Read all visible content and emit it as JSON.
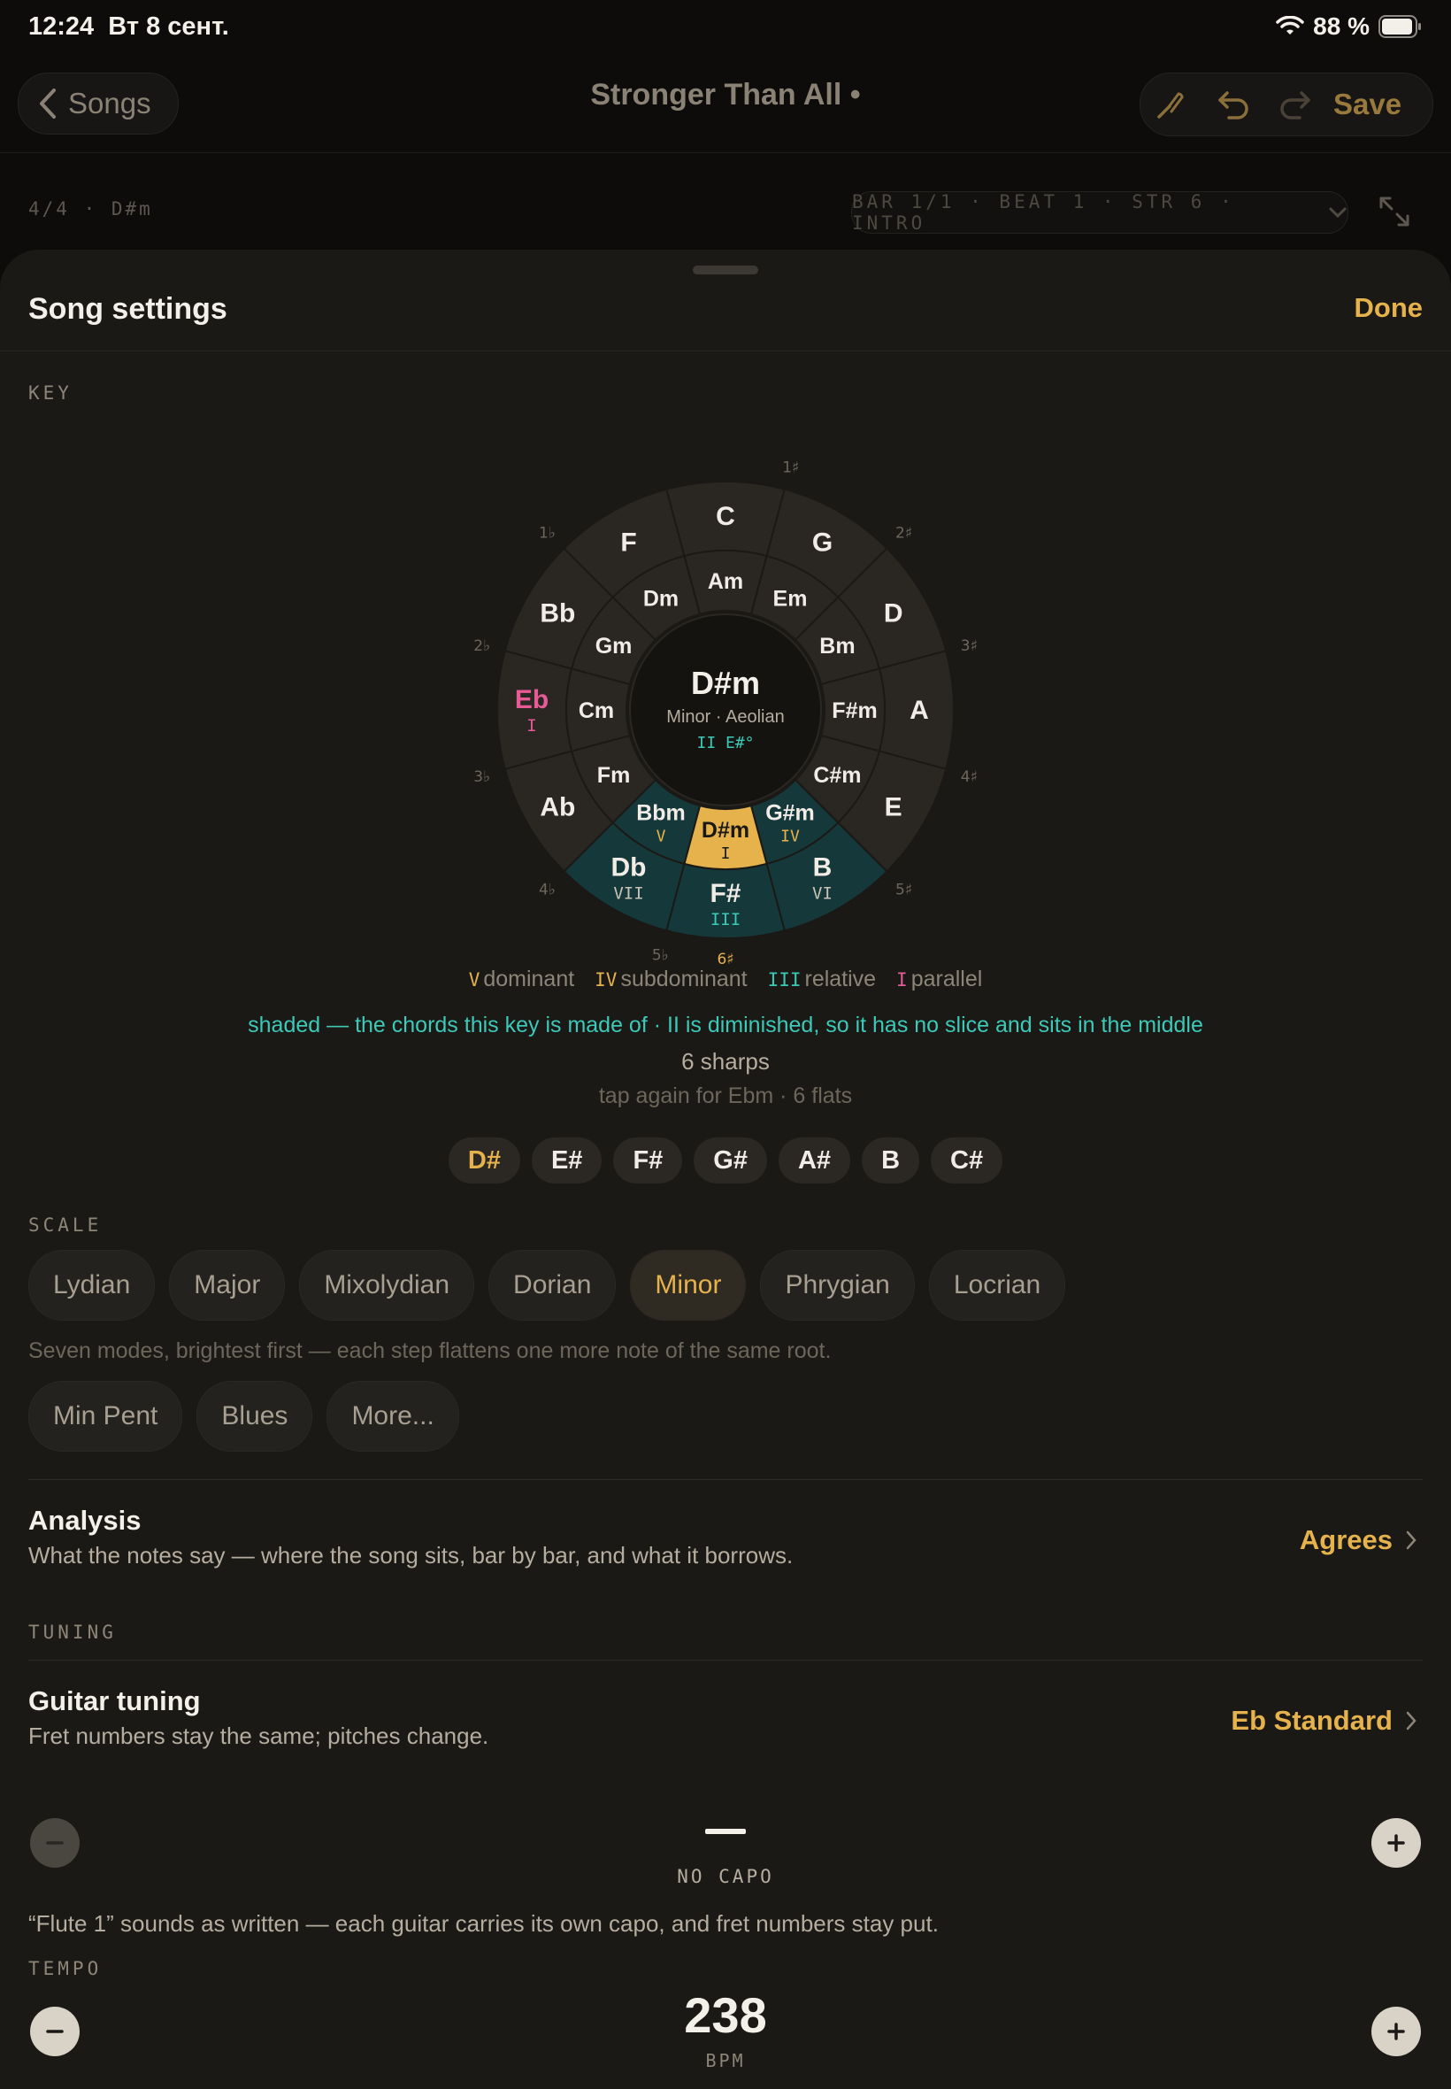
{
  "status_bar": {
    "time": "12:24",
    "date": "Вт 8 сент.",
    "battery": "88 %"
  },
  "nav": {
    "back_label": "Songs",
    "title": "Stronger Than All •",
    "save_label": "Save"
  },
  "info": {
    "meter_key": "4/4 · D#m",
    "position": "BAR 1/1 · BEAT 1 · STR 6 · INTRO"
  },
  "sheet": {
    "title": "Song settings",
    "done_label": "Done"
  },
  "key": {
    "section_label": "KEY",
    "center": {
      "name": "D#m",
      "mode": "Minor · Aeolian",
      "diminished": "II E#°"
    },
    "major_ring": [
      "C",
      "G",
      "D",
      "A",
      "E",
      "B",
      "F#",
      "Db",
      "Ab",
      "Eb",
      "Bb",
      "F"
    ],
    "minor_ring": [
      "Am",
      "Em",
      "Bm",
      "F#m",
      "C#m",
      "G#m",
      "D#m",
      "Bbm",
      "Fm",
      "Cm",
      "Gm",
      "Dm"
    ],
    "roman": {
      "Db": "VII",
      "F#": "III",
      "B": "VI",
      "Bbm": "V",
      "D#m": "I",
      "G#m": "IV",
      "Eb": "I"
    },
    "signatures": {
      "top": "",
      "1s": "1♯",
      "2s": "2♯",
      "3s": "3♯",
      "4s": "4♯",
      "5s": "5♯",
      "6s": "6♯",
      "1f": "1♭",
      "2f": "2♭",
      "3f": "3♭",
      "4f": "4♭",
      "5f": "5♭"
    },
    "legend": [
      {
        "sym": "V",
        "label": "dominant",
        "color": "#e6b24c"
      },
      {
        "sym": "IV",
        "label": "subdominant",
        "color": "#e6b24c"
      },
      {
        "sym": "III",
        "label": "relative",
        "color": "#3cc9b7"
      },
      {
        "sym": "I",
        "label": "parallel",
        "color": "#e65a96"
      }
    ],
    "shaded_note": "shaded — the chords this key is made of · II is diminished, so it has no slice and sits in the middle",
    "sharps": "6 sharps",
    "tap_note": "tap again for Ebm · 6 flats",
    "notes": [
      "D#",
      "E#",
      "F#",
      "G#",
      "A#",
      "B",
      "C#"
    ]
  },
  "scale": {
    "section_label": "SCALE",
    "modes": [
      "Lydian",
      "Major",
      "Mixolydian",
      "Dorian",
      "Minor",
      "Phrygian",
      "Locrian"
    ],
    "selected": "Minor",
    "helper": "Seven modes, brightest first — each step flattens one more note of the same root.",
    "extra": [
      "Min Pent",
      "Blues",
      "More..."
    ]
  },
  "analysis": {
    "title": "Analysis",
    "subtitle": "What the notes say — where the song sits, bar by bar, and what it borrows.",
    "value": "Agrees"
  },
  "tuning": {
    "section_label": "TUNING",
    "title": "Guitar tuning",
    "subtitle": "Fret numbers stay the same; pitches change.",
    "value": "Eb Standard",
    "capo_label": "NO CAPO",
    "capo_note": "“Flute 1” sounds as written — each guitar carries its own capo, and fret numbers stay put."
  },
  "tempo": {
    "section_label": "TEMPO",
    "value": "238",
    "unit": "BPM"
  },
  "colors": {
    "accent": "#e6b24c",
    "teal": "#3cc9b7",
    "pink": "#e65a96",
    "tonic_fill": "#e6b24c",
    "diatonic_fill": "#15393a",
    "ring_fill": "#2a2723"
  }
}
